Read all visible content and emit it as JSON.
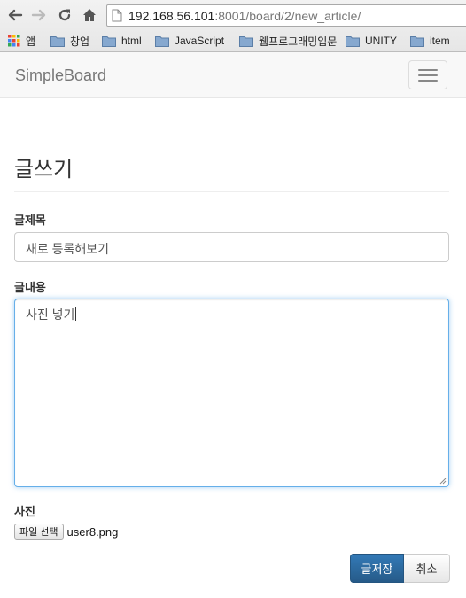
{
  "browser": {
    "url_host": "192.168.56.101",
    "url_rest": ":8001/board/2/new_article/",
    "bookmarks": [
      {
        "label": "앱",
        "icon": "apps-grid-icon"
      },
      {
        "label": "창업",
        "icon": "folder-icon"
      },
      {
        "label": "html",
        "icon": "folder-icon"
      },
      {
        "label": "JavaScript",
        "icon": "folder-icon"
      },
      {
        "label": "웹프로그래밍입문",
        "icon": "folder-icon"
      },
      {
        "label": "UNITY",
        "icon": "folder-icon"
      },
      {
        "label": "item",
        "icon": "folder-icon"
      }
    ]
  },
  "navbar": {
    "brand": "SimpleBoard",
    "toggle_icon": "hamburger-menu-icon"
  },
  "form": {
    "page_title": "글쓰기",
    "title_label": "글제목",
    "title_value": "새로 등록해보기",
    "content_label": "글내용",
    "content_value": "사진 넣기",
    "photo_label": "사진",
    "file_button": "파일 선택",
    "file_name": "user8.png",
    "save_button": "글저장",
    "cancel_button": "취소"
  },
  "colors": {
    "primary": "#337ab7",
    "focus_border": "#66afe9",
    "brand_text": "#777777"
  }
}
